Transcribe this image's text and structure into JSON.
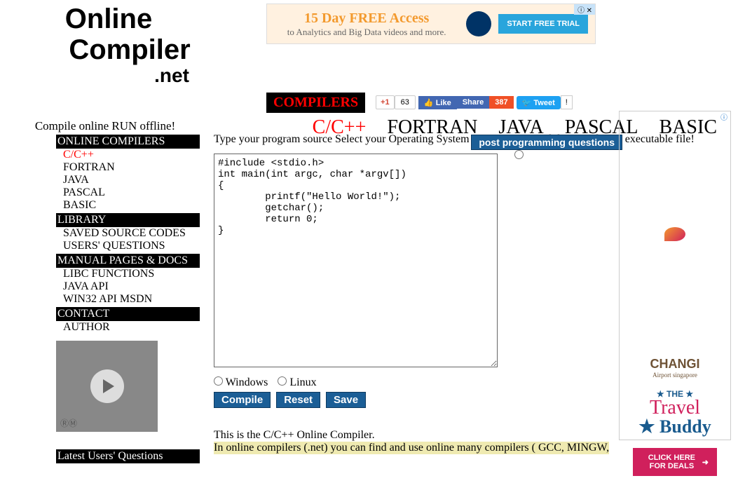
{
  "logo": {
    "line1": "Online",
    "line2": "Compiler",
    "line3": ".net"
  },
  "motto": "Compile online RUN offline!",
  "ad_top": {
    "title": "15 Day FREE Access",
    "sub": "to Analytics and Big Data videos and more.",
    "btn": "START FREE TRIAL"
  },
  "compilers_btn": "COMPILERS",
  "social": {
    "gplus": "+1",
    "gcount": "63",
    "like": "Like",
    "share": "Share",
    "fcount": "387",
    "tweet": "Tweet",
    "tcount": "!"
  },
  "langs": [
    "C/C++",
    "FORTRAN",
    "JAVA",
    "PASCAL",
    "BASIC"
  ],
  "sidebar": {
    "sections": [
      {
        "head": "ONLINE COMPILERS",
        "items": [
          "C/C++",
          "FORTRAN",
          "JAVA",
          "PASCAL",
          "BASIC"
        ]
      },
      {
        "head": "LIBRARY",
        "items": [
          "SAVED SOURCE CODES",
          "USERS' QUESTIONS"
        ]
      },
      {
        "head": "MANUAL PAGES & DOCS",
        "items": [
          "LIBC FUNCTIONS",
          "JAVA API",
          "WIN32 API MSDN"
        ]
      },
      {
        "head": "CONTACT",
        "items": [
          "AUTHOR"
        ]
      }
    ],
    "latest": "Latest Users' Questions"
  },
  "content": {
    "instruct": "Type your program source Select your Operating System click compile and download your executable file!",
    "post_btn": "post programming questions",
    "code": "#include <stdio.h>\nint main(int argc, char *argv[])\n{\n        printf(\"Hello World!\");\n        getchar();\n        return 0;\n}",
    "os": {
      "win": "Windows",
      "lin": "Linux"
    },
    "btns": {
      "compile": "Compile",
      "reset": "Reset",
      "save": "Save"
    },
    "desc1": "This is the C/C++ Online Compiler.",
    "desc2": "In online compilers (.net) you can find and use online many compilers ( GCC, MINGW,"
  },
  "ad_side": {
    "changi": "CHANGI",
    "changi_sub": "Airport singapore",
    "the": "THE",
    "travel": "Travel",
    "buddy": "Buddy",
    "deals": "CLICK HERE FOR DEALS"
  }
}
